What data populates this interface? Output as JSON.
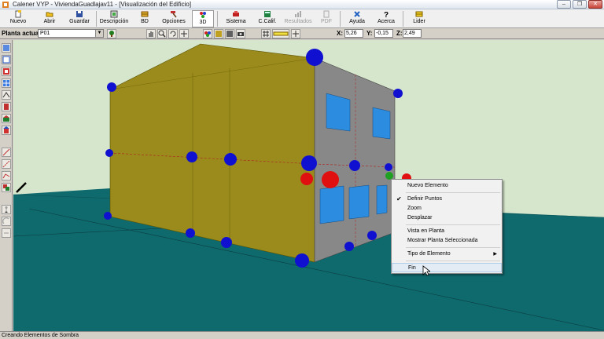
{
  "window": {
    "title": "Calener VYP - ViviendaGuadlajav11 - [Visualización del Edificio]"
  },
  "toolbar": {
    "buttons": [
      {
        "label": "Nuevo",
        "icon": "new-file-icon",
        "enabled": true
      },
      {
        "label": "Abrir",
        "icon": "open-folder-icon",
        "enabled": true
      },
      {
        "label": "Guardar",
        "icon": "save-disk-icon",
        "enabled": true
      },
      {
        "label": "Descripción",
        "icon": "description-icon",
        "enabled": true
      },
      {
        "label": "BD",
        "icon": "database-icon",
        "enabled": true
      },
      {
        "label": "Opciones",
        "icon": "hammer-icon",
        "enabled": true
      },
      {
        "label": "3D",
        "icon": "3d-view-icon",
        "enabled": true,
        "active": true
      },
      {
        "label": "Sistema",
        "icon": "system-icon",
        "enabled": true
      },
      {
        "label": "C.Calif.",
        "icon": "calculate-icon",
        "enabled": true
      },
      {
        "label": "Resultados",
        "icon": "results-chart-icon",
        "enabled": false
      },
      {
        "label": "PDF",
        "icon": "pdf-icon",
        "enabled": false
      },
      {
        "label": "Ayuda",
        "icon": "help-icon",
        "enabled": true
      },
      {
        "label": "Acerca",
        "icon": "question-icon",
        "enabled": true
      },
      {
        "label": "Lider",
        "icon": "lider-icon",
        "enabled": true
      }
    ]
  },
  "planta": {
    "label": "Planta actual",
    "value": "P01"
  },
  "coords": {
    "x_label": "X:",
    "x": "5,26",
    "y_label": "Y:",
    "y": "-0,15",
    "z_label": "Z:",
    "z": "2,49"
  },
  "context_menu": {
    "items": [
      {
        "label": "Nuevo Elemento",
        "checked": false
      },
      {
        "label": "Definir Puntos",
        "checked": true
      },
      {
        "label": "Zoom",
        "checked": false
      },
      {
        "label": "Desplazar",
        "checked": false
      },
      {
        "label": "Vista en Planta",
        "checked": false
      },
      {
        "label": "Mostrar Planta Seleccionada",
        "checked": false
      },
      {
        "label": "Tipo de Elemento",
        "checked": false,
        "submenu": true
      },
      {
        "label": "Fin",
        "checked": false,
        "hovered": true
      }
    ]
  },
  "status": {
    "text": "Creando Elementos de Sombra"
  },
  "colors": {
    "sky": "#d6e6cc",
    "ground": "#0f6a6e",
    "wall_front": "#9a8b1c",
    "wall_side": "#888888",
    "window": "#2c8de0",
    "node_blue": "#1010d0",
    "node_red": "#e01010"
  }
}
